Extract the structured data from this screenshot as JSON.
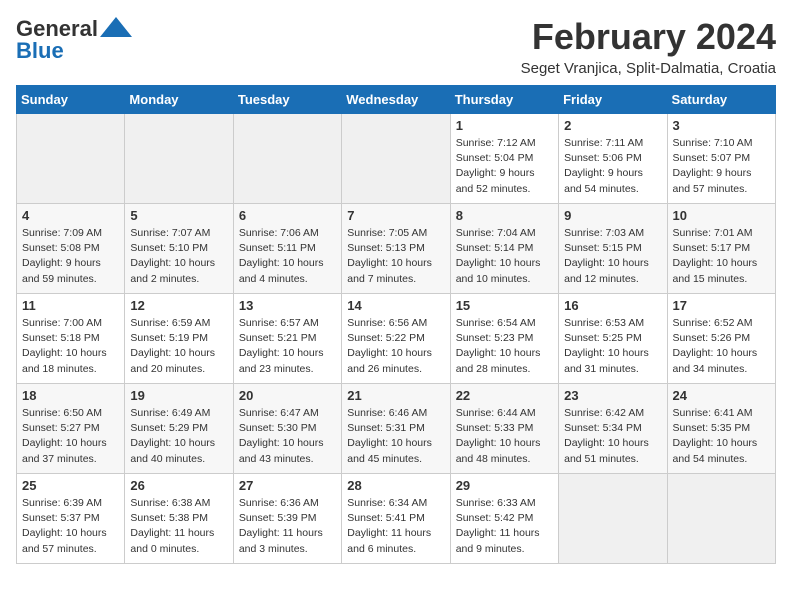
{
  "header": {
    "logo_general": "General",
    "logo_blue": "Blue",
    "month": "February 2024",
    "location": "Seget Vranjica, Split-Dalmatia, Croatia"
  },
  "weekdays": [
    "Sunday",
    "Monday",
    "Tuesday",
    "Wednesday",
    "Thursday",
    "Friday",
    "Saturday"
  ],
  "weeks": [
    [
      {
        "day": "",
        "info": ""
      },
      {
        "day": "",
        "info": ""
      },
      {
        "day": "",
        "info": ""
      },
      {
        "day": "",
        "info": ""
      },
      {
        "day": "1",
        "info": "Sunrise: 7:12 AM\nSunset: 5:04 PM\nDaylight: 9 hours\nand 52 minutes."
      },
      {
        "day": "2",
        "info": "Sunrise: 7:11 AM\nSunset: 5:06 PM\nDaylight: 9 hours\nand 54 minutes."
      },
      {
        "day": "3",
        "info": "Sunrise: 7:10 AM\nSunset: 5:07 PM\nDaylight: 9 hours\nand 57 minutes."
      }
    ],
    [
      {
        "day": "4",
        "info": "Sunrise: 7:09 AM\nSunset: 5:08 PM\nDaylight: 9 hours\nand 59 minutes."
      },
      {
        "day": "5",
        "info": "Sunrise: 7:07 AM\nSunset: 5:10 PM\nDaylight: 10 hours\nand 2 minutes."
      },
      {
        "day": "6",
        "info": "Sunrise: 7:06 AM\nSunset: 5:11 PM\nDaylight: 10 hours\nand 4 minutes."
      },
      {
        "day": "7",
        "info": "Sunrise: 7:05 AM\nSunset: 5:13 PM\nDaylight: 10 hours\nand 7 minutes."
      },
      {
        "day": "8",
        "info": "Sunrise: 7:04 AM\nSunset: 5:14 PM\nDaylight: 10 hours\nand 10 minutes."
      },
      {
        "day": "9",
        "info": "Sunrise: 7:03 AM\nSunset: 5:15 PM\nDaylight: 10 hours\nand 12 minutes."
      },
      {
        "day": "10",
        "info": "Sunrise: 7:01 AM\nSunset: 5:17 PM\nDaylight: 10 hours\nand 15 minutes."
      }
    ],
    [
      {
        "day": "11",
        "info": "Sunrise: 7:00 AM\nSunset: 5:18 PM\nDaylight: 10 hours\nand 18 minutes."
      },
      {
        "day": "12",
        "info": "Sunrise: 6:59 AM\nSunset: 5:19 PM\nDaylight: 10 hours\nand 20 minutes."
      },
      {
        "day": "13",
        "info": "Sunrise: 6:57 AM\nSunset: 5:21 PM\nDaylight: 10 hours\nand 23 minutes."
      },
      {
        "day": "14",
        "info": "Sunrise: 6:56 AM\nSunset: 5:22 PM\nDaylight: 10 hours\nand 26 minutes."
      },
      {
        "day": "15",
        "info": "Sunrise: 6:54 AM\nSunset: 5:23 PM\nDaylight: 10 hours\nand 28 minutes."
      },
      {
        "day": "16",
        "info": "Sunrise: 6:53 AM\nSunset: 5:25 PM\nDaylight: 10 hours\nand 31 minutes."
      },
      {
        "day": "17",
        "info": "Sunrise: 6:52 AM\nSunset: 5:26 PM\nDaylight: 10 hours\nand 34 minutes."
      }
    ],
    [
      {
        "day": "18",
        "info": "Sunrise: 6:50 AM\nSunset: 5:27 PM\nDaylight: 10 hours\nand 37 minutes."
      },
      {
        "day": "19",
        "info": "Sunrise: 6:49 AM\nSunset: 5:29 PM\nDaylight: 10 hours\nand 40 minutes."
      },
      {
        "day": "20",
        "info": "Sunrise: 6:47 AM\nSunset: 5:30 PM\nDaylight: 10 hours\nand 43 minutes."
      },
      {
        "day": "21",
        "info": "Sunrise: 6:46 AM\nSunset: 5:31 PM\nDaylight: 10 hours\nand 45 minutes."
      },
      {
        "day": "22",
        "info": "Sunrise: 6:44 AM\nSunset: 5:33 PM\nDaylight: 10 hours\nand 48 minutes."
      },
      {
        "day": "23",
        "info": "Sunrise: 6:42 AM\nSunset: 5:34 PM\nDaylight: 10 hours\nand 51 minutes."
      },
      {
        "day": "24",
        "info": "Sunrise: 6:41 AM\nSunset: 5:35 PM\nDaylight: 10 hours\nand 54 minutes."
      }
    ],
    [
      {
        "day": "25",
        "info": "Sunrise: 6:39 AM\nSunset: 5:37 PM\nDaylight: 10 hours\nand 57 minutes."
      },
      {
        "day": "26",
        "info": "Sunrise: 6:38 AM\nSunset: 5:38 PM\nDaylight: 11 hours\nand 0 minutes."
      },
      {
        "day": "27",
        "info": "Sunrise: 6:36 AM\nSunset: 5:39 PM\nDaylight: 11 hours\nand 3 minutes."
      },
      {
        "day": "28",
        "info": "Sunrise: 6:34 AM\nSunset: 5:41 PM\nDaylight: 11 hours\nand 6 minutes."
      },
      {
        "day": "29",
        "info": "Sunrise: 6:33 AM\nSunset: 5:42 PM\nDaylight: 11 hours\nand 9 minutes."
      },
      {
        "day": "",
        "info": ""
      },
      {
        "day": "",
        "info": ""
      }
    ]
  ]
}
